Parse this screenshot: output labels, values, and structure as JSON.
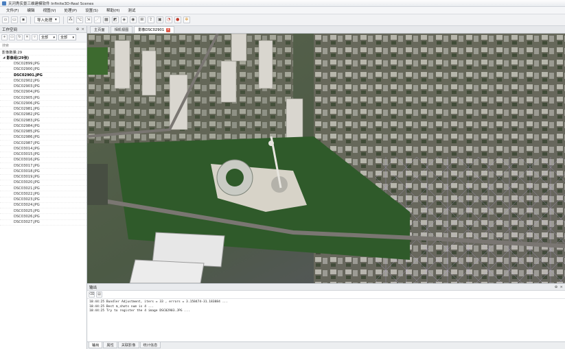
{
  "window": {
    "title": "天河秀实景三维建模软件 Infinite3D-Real Scenes"
  },
  "menu": [
    "文件(F)",
    "编辑",
    "视图(V)",
    "处理(P)",
    "设置(S)",
    "帮助(H)",
    "测试"
  ],
  "toolbar": {
    "dropdown_label": "导入处理"
  },
  "left_panel": {
    "title": "工作空间",
    "select_a": "全部",
    "select_b": "全部",
    "search_placeholder": "搜索",
    "root_label": "影像数量:29",
    "group_label": "影像组(29张)",
    "files": [
      {
        "name": "DSC02899.JPG",
        "bold": false
      },
      {
        "name": "DSC02900.JPG",
        "bold": false
      },
      {
        "name": "DSC02901.JPG",
        "bold": true
      },
      {
        "name": "DSC02902.JPG",
        "bold": false
      },
      {
        "name": "DSC02903.JPG",
        "bold": false
      },
      {
        "name": "DSC02904.JPG",
        "bold": false
      },
      {
        "name": "DSC02905.JPG",
        "bold": false
      },
      {
        "name": "DSC02906.JPG",
        "bold": false
      },
      {
        "name": "DSC02981.JPG",
        "bold": false
      },
      {
        "name": "DSC02982.JPG",
        "bold": false
      },
      {
        "name": "DSC02983.JPG",
        "bold": false
      },
      {
        "name": "DSC02984.JPG",
        "bold": false
      },
      {
        "name": "DSC02985.JPG",
        "bold": false
      },
      {
        "name": "DSC02986.JPG",
        "bold": false
      },
      {
        "name": "DSC02987.JPG",
        "bold": false
      },
      {
        "name": "DSC03014.JPG",
        "bold": false
      },
      {
        "name": "DSC03015.JPG",
        "bold": false
      },
      {
        "name": "DSC03016.JPG",
        "bold": false
      },
      {
        "name": "DSC03017.JPG",
        "bold": false
      },
      {
        "name": "DSC03018.JPG",
        "bold": false
      },
      {
        "name": "DSC03019.JPG",
        "bold": false
      },
      {
        "name": "DSC03020.JPG",
        "bold": false
      },
      {
        "name": "DSC03021.JPG",
        "bold": false
      },
      {
        "name": "DSC03022.JPG",
        "bold": false
      },
      {
        "name": "DSC03023.JPG",
        "bold": false
      },
      {
        "name": "DSC03024.JPG",
        "bold": false
      },
      {
        "name": "DSC03025.JPG",
        "bold": false
      },
      {
        "name": "DSC03026.JPG",
        "bold": false
      },
      {
        "name": "DSC03027.JPG",
        "bold": false
      }
    ]
  },
  "doc_tabs": [
    {
      "label": "主页面",
      "active": false
    },
    {
      "label": "相机视图",
      "active": false
    },
    {
      "label": "影像DSC02901",
      "active": true
    }
  ],
  "output": {
    "title": "输出",
    "lines": [
      "10:44:25 Bundler Adjustment, iters = 33 , errors = 3.158474-31.183884 ...",
      "10:44:25 Best m_shots num is 4 ...",
      "10:44:25 Try to register the 4 image DSC02903.JPG ..."
    ],
    "tabs": [
      "输出",
      "属性",
      "关联影像",
      "统计信息"
    ]
  },
  "colors": {
    "accent": "#4a7fc0",
    "close_tab": "#e05a4a",
    "record": "#c0392b"
  }
}
